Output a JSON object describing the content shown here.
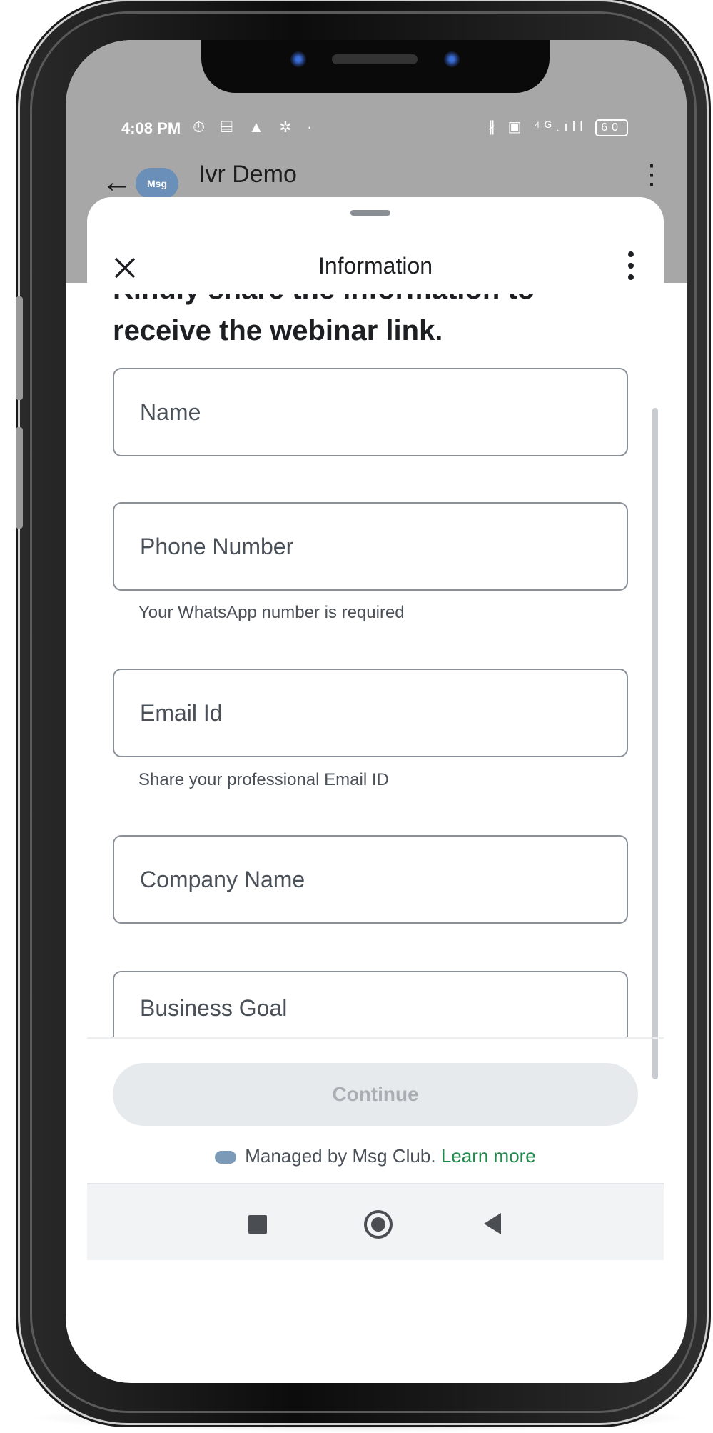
{
  "statusbar": {
    "time": "4:08 PM",
    "left_icons": "⏱ ▤ ▲ ✲ ·",
    "right_icons": "∦ ▣ ⁴ᴳ.ıll",
    "battery": "60"
  },
  "app": {
    "name": "Ivr Demo",
    "logo_text": "Msg"
  },
  "sheet": {
    "title": "Information",
    "cut_text": "Kindly share the information to",
    "heading": "receive the webinar link.",
    "fields": [
      {
        "placeholder": "Name"
      },
      {
        "placeholder": "Phone Number",
        "helper": "Your WhatsApp number is required"
      },
      {
        "placeholder": "Email Id",
        "helper": "Share your professional Email ID"
      },
      {
        "placeholder": "Company Name"
      },
      {
        "placeholder": "Business Goal"
      }
    ],
    "continue_label": "Continue",
    "footer_text": "Managed by Msg Club.",
    "learn_more": "Learn more"
  },
  "icons": {
    "close": "close-icon",
    "kebab": "more-vert-icon",
    "back": "back-arrow-icon",
    "nav_recents": "square-icon",
    "nav_home": "circle-icon",
    "nav_back": "triangle-back-icon"
  },
  "colors": {
    "learn_more": "#1f8a4c",
    "continue_bg_disabled": "#e7eaed",
    "app_overlay": "#a7a7a7"
  }
}
